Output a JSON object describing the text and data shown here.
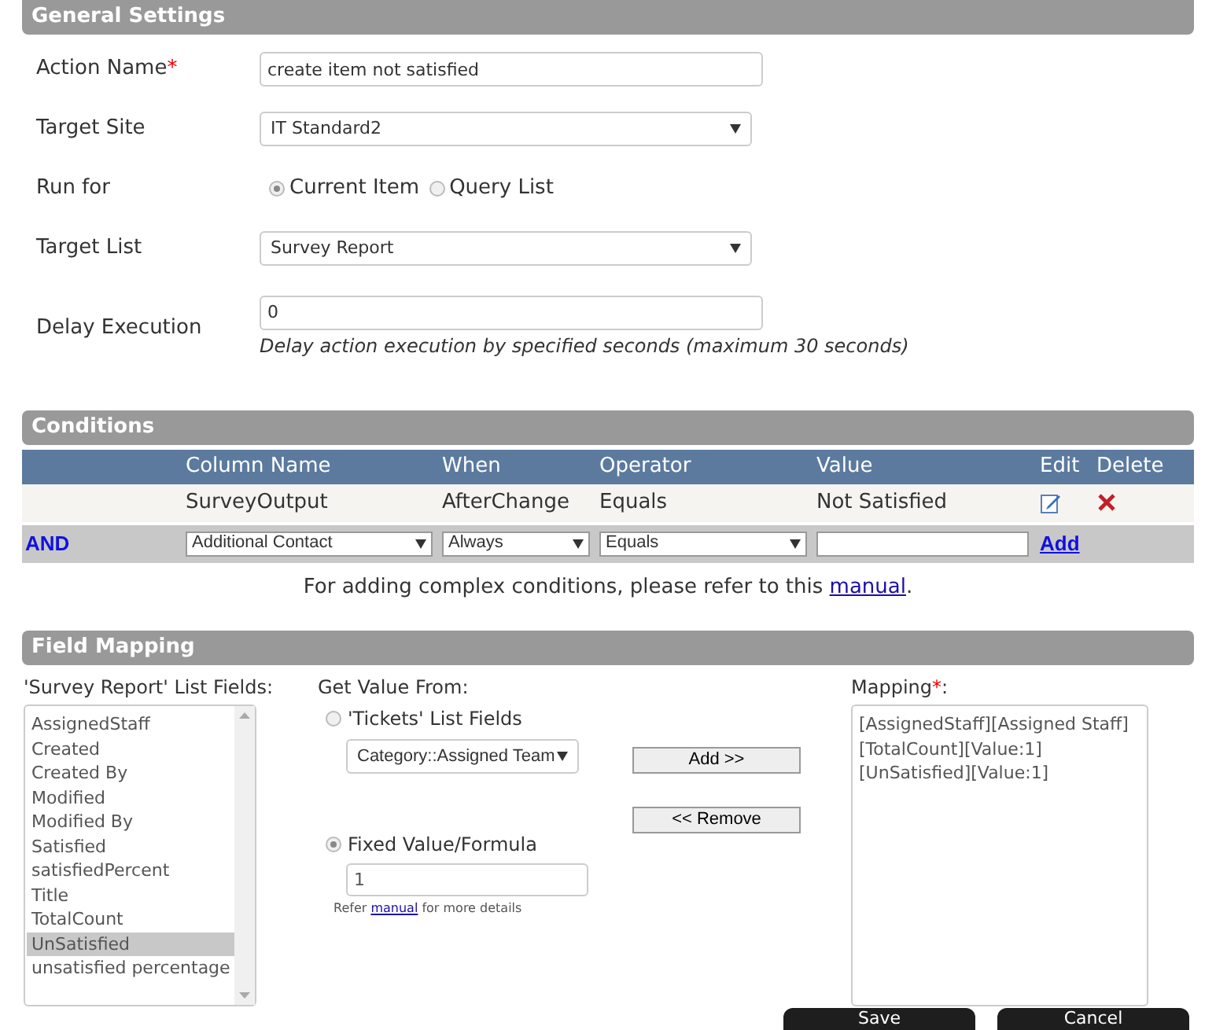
{
  "general_settings": {
    "title": "General Settings",
    "action_name": {
      "label": "Action Name",
      "required_mark": "*",
      "value": "create item not satisfied"
    },
    "target_site": {
      "label": "Target Site",
      "value": "IT Standard2"
    },
    "run_for": {
      "label": "Run for",
      "options": [
        {
          "label": "Current Item",
          "selected": true
        },
        {
          "label": "Query List",
          "selected": false
        }
      ]
    },
    "target_list": {
      "label": "Target List",
      "value": "Survey Report"
    },
    "delay_execution": {
      "label": "Delay Execution",
      "value": "0",
      "hint": "Delay action execution by specified seconds (maximum 30 seconds)"
    }
  },
  "conditions": {
    "title": "Conditions",
    "columns": [
      "Column Name",
      "When",
      "Operator",
      "Value",
      "Edit",
      "Delete"
    ],
    "rows": [
      {
        "column_name": "SurveyOutput",
        "when": "AfterChange",
        "operator": "Equals",
        "value": "Not Satisfied"
      }
    ],
    "new_row": {
      "joiner": "AND",
      "column_name": "Additional Contact",
      "when": "Always",
      "operator": "Equals",
      "add": "Add"
    },
    "note": "For adding complex conditions, please refer to this ",
    "note_link": "manual",
    "note_end": "."
  },
  "field_mapping": {
    "title": "Field Mapping",
    "list_label": "'Survey Report' List Fields:",
    "list_items": [
      {
        "label": "AssignedStaff",
        "selected": false
      },
      {
        "label": "Created",
        "selected": false
      },
      {
        "label": "Created By",
        "selected": false
      },
      {
        "label": "Modified",
        "selected": false
      },
      {
        "label": "Modified By",
        "selected": false
      },
      {
        "label": "Satisfied",
        "selected": false
      },
      {
        "label": "satisfiedPercent",
        "selected": false
      },
      {
        "label": "Title",
        "selected": false
      },
      {
        "label": "TotalCount",
        "selected": false
      },
      {
        "label": "UnSatisfied",
        "selected": true
      },
      {
        "label": "unsatisfied percentage",
        "selected": false
      }
    ],
    "source_label": "Get Value From:",
    "source_options": [
      {
        "label": "'Tickets' List Fields",
        "selected": false,
        "select_value": "Category::Assigned Team"
      },
      {
        "label": "Fixed Value/Formula",
        "selected": true,
        "input_value": "1"
      }
    ],
    "refer_before": "Refer ",
    "refer_link": "manual",
    "refer_after": " for more details",
    "add_button": "Add >>",
    "remove_button": "<< Remove",
    "mapping_label": "Mapping",
    "mapping_required": "*",
    "mapping_colon": ":",
    "mappings": [
      "[AssignedStaff][Assigned Staff]",
      "[TotalCount][Value:1]",
      "[UnSatisfied][Value:1]"
    ]
  },
  "buttons": [
    "Save",
    "Cancel"
  ]
}
